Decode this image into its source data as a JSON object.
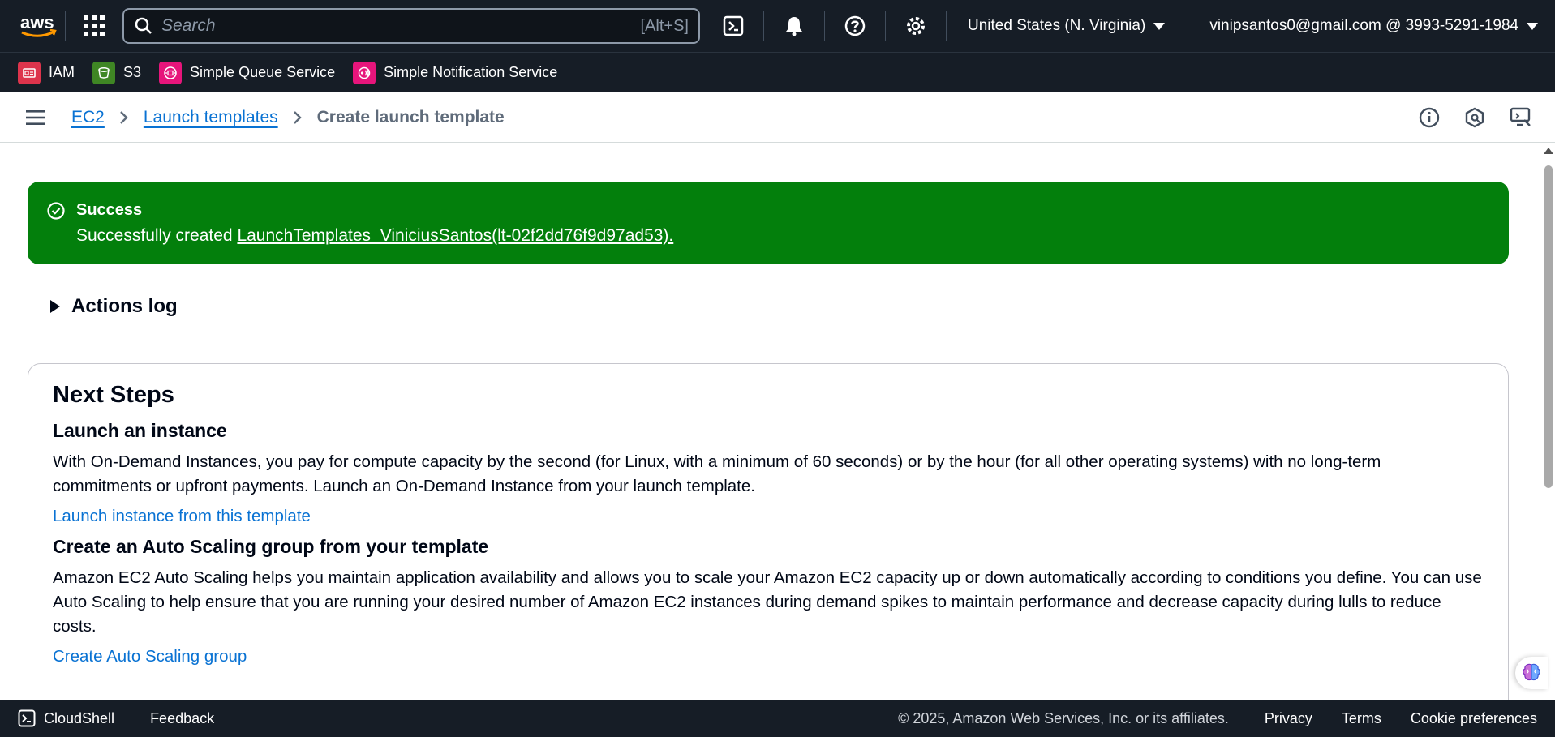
{
  "topnav": {
    "logo_text": "aws",
    "search_placeholder": "Search",
    "search_shortcut": "[Alt+S]",
    "region": "United States (N. Virginia)",
    "account": "vinipsantos0@gmail.com @ 3993-5291-1984"
  },
  "favorites": [
    {
      "label": "IAM",
      "color": "#dd344c"
    },
    {
      "label": "S3",
      "color": "#3f8624"
    },
    {
      "label": "Simple Queue Service",
      "color": "#e7157b"
    },
    {
      "label": "Simple Notification Service",
      "color": "#e7157b"
    }
  ],
  "breadcrumb": {
    "items": [
      "EC2",
      "Launch templates"
    ],
    "current": "Create launch template"
  },
  "flash": {
    "title": "Success",
    "message_prefix": "Successfully created ",
    "link": "LaunchTemplates_ViniciusSantos(lt-02f2dd76f9d97ad53).",
    "color": "#037f0c"
  },
  "actions_log": "Actions log",
  "next_steps": {
    "title": "Next Steps",
    "launch": {
      "heading": "Launch an instance",
      "text": "With On-Demand Instances, you pay for compute capacity by the second (for Linux, with a minimum of 60 seconds) or by the hour (for all other operating systems) with no long-term commitments or upfront payments. Launch an On-Demand Instance from your launch template.",
      "link": "Launch instance from this template"
    },
    "asg": {
      "heading": "Create an Auto Scaling group from your template",
      "text": "Amazon EC2 Auto Scaling helps you maintain application availability and allows you to scale your Amazon EC2 capacity up or down automatically according to conditions you define. You can use Auto Scaling to help ensure that you are running your desired number of Amazon EC2 instances during demand spikes to maintain performance and decrease capacity during lulls to reduce costs.",
      "link": "Create Auto Scaling group"
    }
  },
  "footer": {
    "cloudshell": "CloudShell",
    "feedback": "Feedback",
    "copyright": "© 2025, Amazon Web Services, Inc. or its affiliates.",
    "links": [
      "Privacy",
      "Terms",
      "Cookie preferences"
    ]
  },
  "colors": {
    "nav_bg": "#161d26",
    "link": "#0972d3",
    "success": "#037f0c"
  }
}
